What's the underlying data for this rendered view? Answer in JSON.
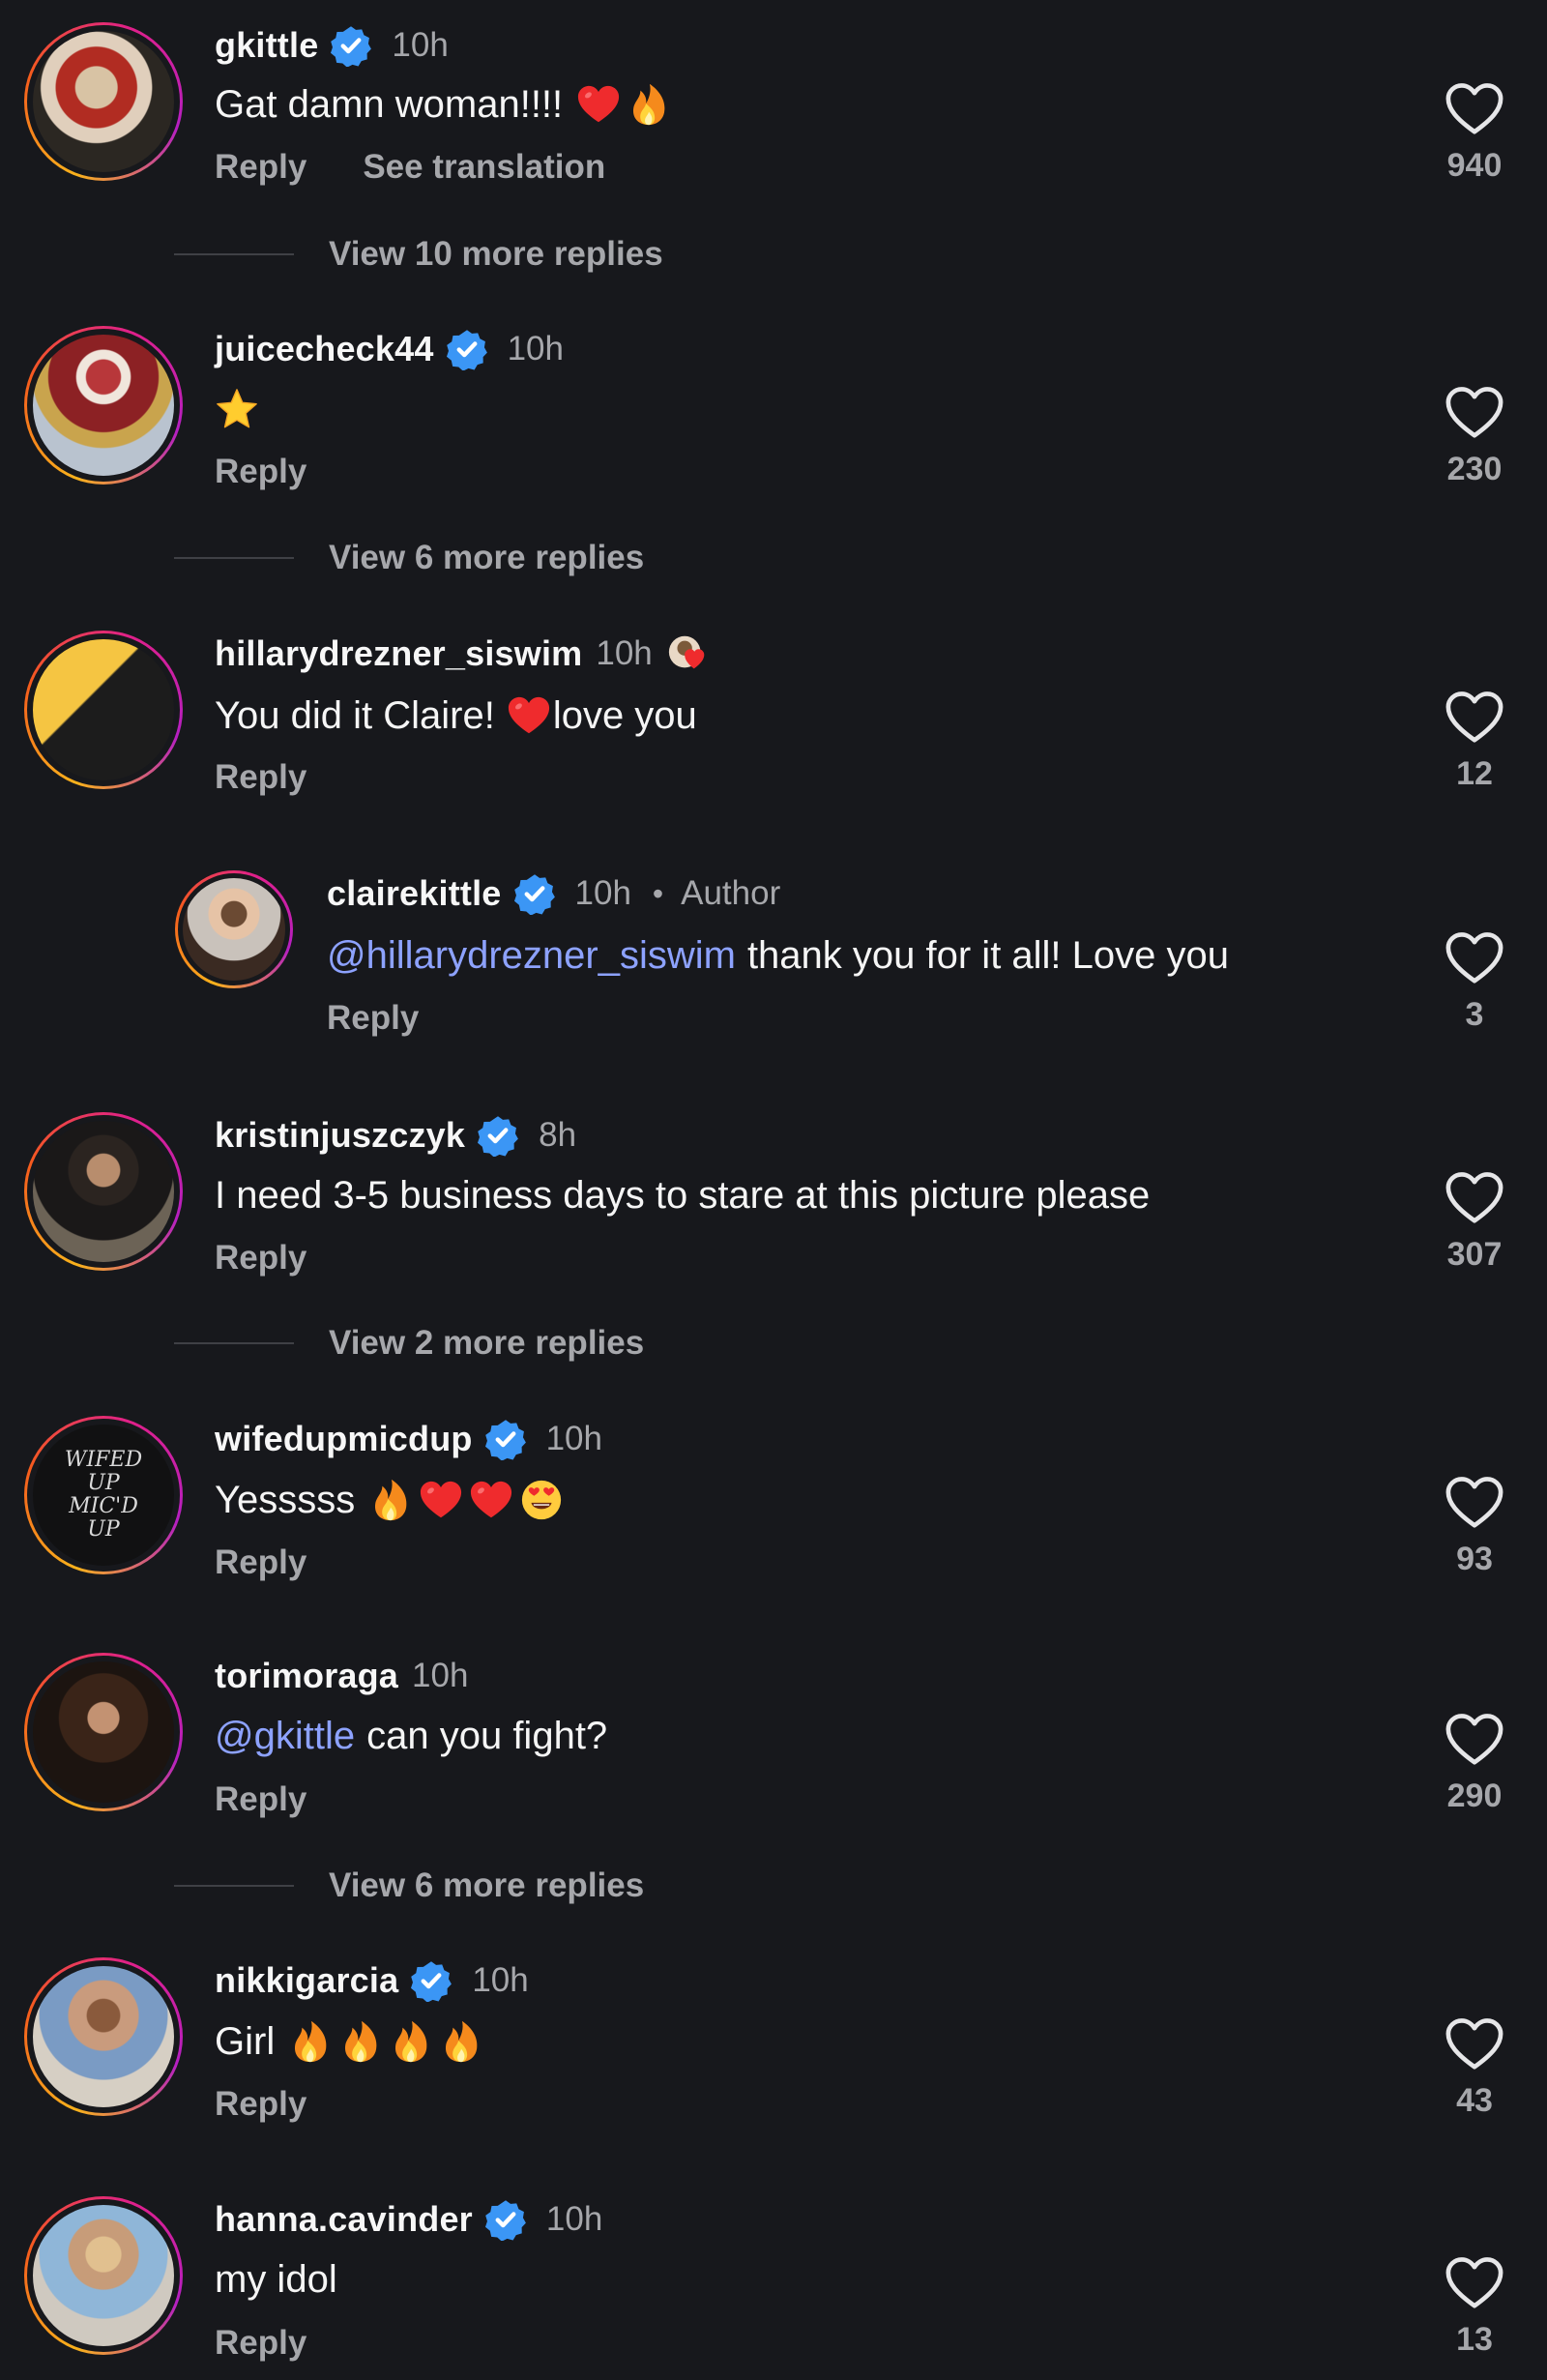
{
  "reply_label": "Reply",
  "see_translation_label": "See translation",
  "author_label": "Author",
  "accent_colors": {
    "mention": "#8da2ff",
    "verified": "#3b96f5",
    "background": "#17181c"
  },
  "comments": [
    {
      "username": "gkittle",
      "verified": true,
      "time": "10h",
      "text": "Gat damn woman!!!!",
      "emojis": [
        "red-heart",
        "fire"
      ],
      "likes": "940",
      "view_more": "View 10 more replies"
    },
    {
      "username": "juicecheck44",
      "verified": true,
      "time": "10h",
      "text": "",
      "emojis": [
        "star"
      ],
      "likes": "230",
      "view_more": "View 6 more replies"
    },
    {
      "username": "hillarydrezner_siswim",
      "verified": false,
      "time": "10h",
      "text_before": "You did it Claire!",
      "text_after": "love you",
      "emojis": [
        "red-heart"
      ],
      "likes": "12"
    },
    {
      "username": "clairekittle",
      "verified": true,
      "time": "10h",
      "is_author": true,
      "mention": "@hillarydrezner_siswim",
      "text": "thank you for it all! Love you",
      "likes": "3"
    },
    {
      "username": "kristinjuszczyk",
      "verified": true,
      "time": "8h",
      "text": "I need 3-5 business days to stare at this picture please",
      "likes": "307",
      "view_more": "View 2 more replies"
    },
    {
      "username": "wifedupmicdup",
      "verified": true,
      "time": "10h",
      "text": "Yesssss",
      "emojis": [
        "fire",
        "red-heart",
        "red-heart",
        "heart-eyes"
      ],
      "likes": "93",
      "avatar_text": "WIFED UP MIC'D UP"
    },
    {
      "username": "torimoraga",
      "verified": false,
      "time": "10h",
      "mention": "@gkittle",
      "text": "can you fight?",
      "likes": "290",
      "view_more": "View 6 more replies"
    },
    {
      "username": "nikkigarcia",
      "verified": true,
      "time": "10h",
      "text": "Girl",
      "emojis": [
        "fire",
        "fire",
        "fire",
        "fire"
      ],
      "likes": "43"
    },
    {
      "username": "hanna.cavinder",
      "verified": true,
      "time": "10h",
      "text": "my idol",
      "likes": "13"
    }
  ]
}
